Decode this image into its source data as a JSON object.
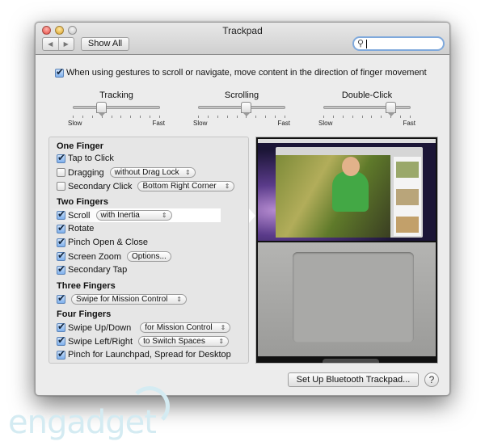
{
  "window": {
    "title": "Trackpad"
  },
  "toolbar": {
    "back_icon": "◀",
    "forward_icon": "▶",
    "show_all": "Show All",
    "search_value": "",
    "search_icon": "⚲"
  },
  "natural_scroll": {
    "label": "When using gestures to scroll or navigate, move content in the direction of finger movement",
    "checked": true
  },
  "sliders": [
    {
      "label": "Tracking",
      "min_label": "Slow",
      "max_label": "Fast",
      "value": 0.33
    },
    {
      "label": "Scrolling",
      "min_label": "Slow",
      "max_label": "Fast",
      "value": 0.56
    },
    {
      "label": "Double-Click",
      "min_label": "Slow",
      "max_label": "Fast",
      "value": 0.78
    }
  ],
  "sections": {
    "one": "One Finger",
    "two": "Two Fingers",
    "three": "Three Fingers",
    "four": "Four Fingers"
  },
  "options": {
    "tap_to_click": {
      "label": "Tap to Click",
      "checked": true
    },
    "dragging": {
      "label": "Dragging",
      "checked": false,
      "popup": "without Drag Lock"
    },
    "secondary_click": {
      "label": "Secondary Click",
      "checked": false,
      "popup": "Bottom Right Corner"
    },
    "scroll": {
      "label": "Scroll",
      "checked": true,
      "popup": "with Inertia"
    },
    "rotate": {
      "label": "Rotate",
      "checked": true
    },
    "pinch": {
      "label": "Pinch Open & Close",
      "checked": true
    },
    "screen_zoom": {
      "label": "Screen Zoom",
      "checked": true,
      "button": "Options..."
    },
    "secondary_tap": {
      "label": "Secondary Tap",
      "checked": true
    },
    "three_swipe": {
      "checked": true,
      "popup": "Swipe for Mission Control"
    },
    "swipe_updown": {
      "label": "Swipe Up/Down",
      "checked": true,
      "popup": "for Mission Control"
    },
    "swipe_leftright": {
      "label": "Swipe Left/Right",
      "checked": true,
      "popup": "to Switch Spaces"
    },
    "launchpad": {
      "label": "Pinch for Launchpad, Spread for Desktop",
      "checked": true
    }
  },
  "footer": {
    "bluetooth_button": "Set Up Bluetooth Trackpad...",
    "help": "?"
  },
  "watermark": "engadget"
}
